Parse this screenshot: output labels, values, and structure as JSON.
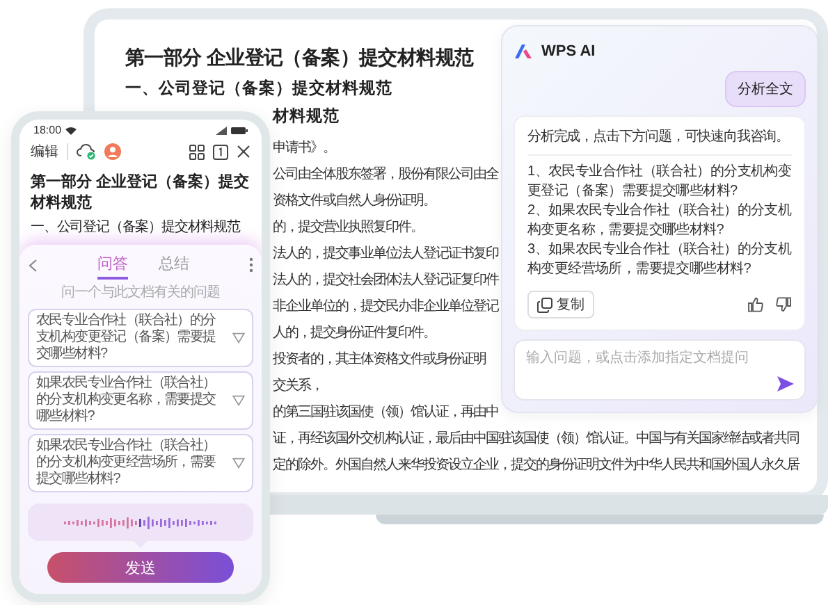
{
  "laptop_document": {
    "title": "第一部分 企业登记（备案）提交材料规范",
    "heading": "一、公司登记（备案）提交材料规范",
    "subheading": "材料规范",
    "lines": [
      "申请书》。",
      "公司由全体股东签署，股份有限公司由全",
      "资格文件或自然人身份证明。",
      "的，提交营业执照复印件。",
      "法人的，提交事业单位法人登记证书复印",
      "法人的，提交社会团体法人登记证复印件",
      "非企业单位的，提交民办非企业单位登记",
      "人的，提交身份证件复印件。",
      "投资者的，其主体资格文件或身份证明",
      "交关系，",
      "的第三国驻该国使（领）馆认证，再由中",
      "证，再经该国外交机构认证，最后由中国驻该国使（领）馆认证。中国与有关国家缔结或者共同",
      "定的除外。外国自然人来华投资设立企业，提交的身份证明文件为中华人民共和国外国人永久居"
    ]
  },
  "ai_panel": {
    "title": "WPS AI",
    "user_message": "分析全文",
    "answer": {
      "intro": "分析完成，点击下方问题，可快速向我咨询。",
      "questions": [
        "1、农民专业合作社（联合社）的分支机构变更登记（备案）需要提交哪些材料?",
        "2、如果农民专业合作社（联合社）的分支机构变更名称，需要提交哪些材料?",
        "3、如果农民专业合作社（联合社）的分支机构变更经营场所，需要提交哪些材料?"
      ]
    },
    "copy_button": "复制",
    "input": {
      "placeholder": "输入问题，或点击添加指定文档提问"
    }
  },
  "phone": {
    "status_time": "18:00",
    "toolbar": {
      "edit_label": "编辑"
    },
    "document": {
      "title": "第一部分 企业登记（备案）提交材料规范",
      "heading": "一、公司登记（备案）提交材料规范"
    },
    "tabs": [
      {
        "label": "问答",
        "selected": true
      },
      {
        "label": "总结",
        "selected": false
      }
    ],
    "hint": "问一个与此文档有关的问题",
    "questions": [
      "农民专业合作社（联合社）的分支机构变更登记（备案）需要提交哪些材料?",
      "如果农民专业合作社（联合社）的分支机构变更名称，需要提交哪些材料?",
      "如果农民专业合作社（联合社）的分支机构变更经营场所，需要提交哪些材料?"
    ],
    "send_button": "发送"
  }
}
